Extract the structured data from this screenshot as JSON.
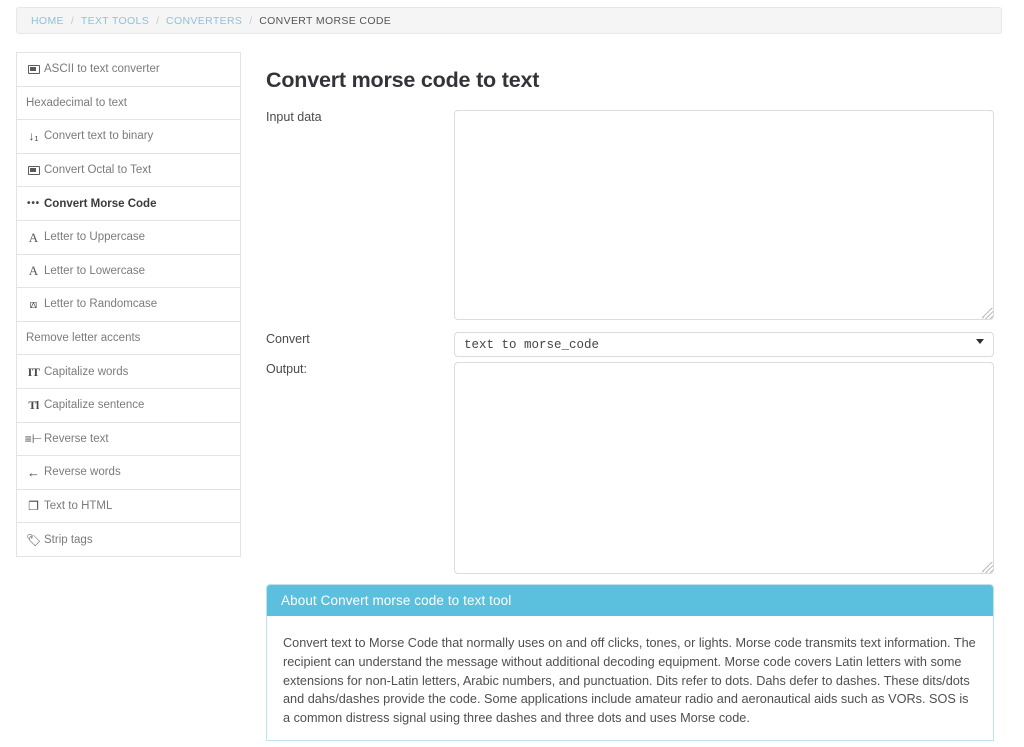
{
  "breadcrumb": {
    "items": [
      {
        "label": "HOME",
        "current": false
      },
      {
        "label": "TEXT TOOLS",
        "current": false
      },
      {
        "label": "CONVERTERS",
        "current": false
      },
      {
        "label": "CONVERT MORSE CODE",
        "current": true
      }
    ],
    "separator": "/"
  },
  "sidebar": {
    "items": [
      {
        "label": "ASCII to text converter",
        "icon": "ascii-box-icon",
        "active": false
      },
      {
        "label": "Hexadecimal to text",
        "icon": "none",
        "active": false
      },
      {
        "label": "Convert text to binary",
        "icon": "sort-binary-icon",
        "active": false
      },
      {
        "label": "Convert Octal to Text",
        "icon": "octal-box-icon",
        "active": false
      },
      {
        "label": "Convert Morse Code",
        "icon": "morse-dots-icon",
        "active": true
      },
      {
        "label": "Letter to Uppercase",
        "icon": "letter-a-icon",
        "active": false
      },
      {
        "label": "Letter to Lowercase",
        "icon": "letter-a-icon",
        "active": false
      },
      {
        "label": "Letter to Randomcase",
        "icon": "shuffle-icon",
        "active": false
      },
      {
        "label": "Remove letter accents",
        "icon": "none",
        "active": false
      },
      {
        "label": "Capitalize words",
        "icon": "it-text-icon",
        "active": false
      },
      {
        "label": "Capitalize sentence",
        "icon": "tl-text-icon",
        "active": false
      },
      {
        "label": "Reverse text",
        "icon": "reverse-text-icon",
        "active": false
      },
      {
        "label": "Reverse words",
        "icon": "arrow-left-icon",
        "active": false
      },
      {
        "label": "Text to HTML",
        "icon": "copy-page-icon",
        "active": false
      },
      {
        "label": "Strip tags",
        "icon": "tag-icon",
        "active": false
      }
    ]
  },
  "main": {
    "title": "Convert morse code to text",
    "input_label": "Input data",
    "input_value": "",
    "input_placeholder": "",
    "convert_label": "Convert",
    "convert_selected": "text to morse_code",
    "convert_options": [
      "text to morse_code"
    ],
    "output_label": "Output:",
    "output_value": "",
    "output_placeholder": ""
  },
  "about": {
    "heading": "About Convert morse code to text tool",
    "body": "Convert text to Morse Code that normally uses on and off clicks, tones, or lights. Morse code transmits text information.  The recipient can understand the message without additional decoding equipment.  Morse code covers Latin letters with some extensions for non-Latin letters, Arabic numbers, and punctuation.  Dits refer to dots.  Dahs defer to dashes. These dits/dots and dahs/dashes provide the code.  Some applications include amateur radio and aeronautical aids such as VORs. SOS is a common distress signal using three dashes and three dots and uses Morse code."
  },
  "colors": {
    "accent": "#5bc0de",
    "link": "#8ec3d7",
    "text": "#4f4f4f",
    "border": "#e3e3e3"
  }
}
